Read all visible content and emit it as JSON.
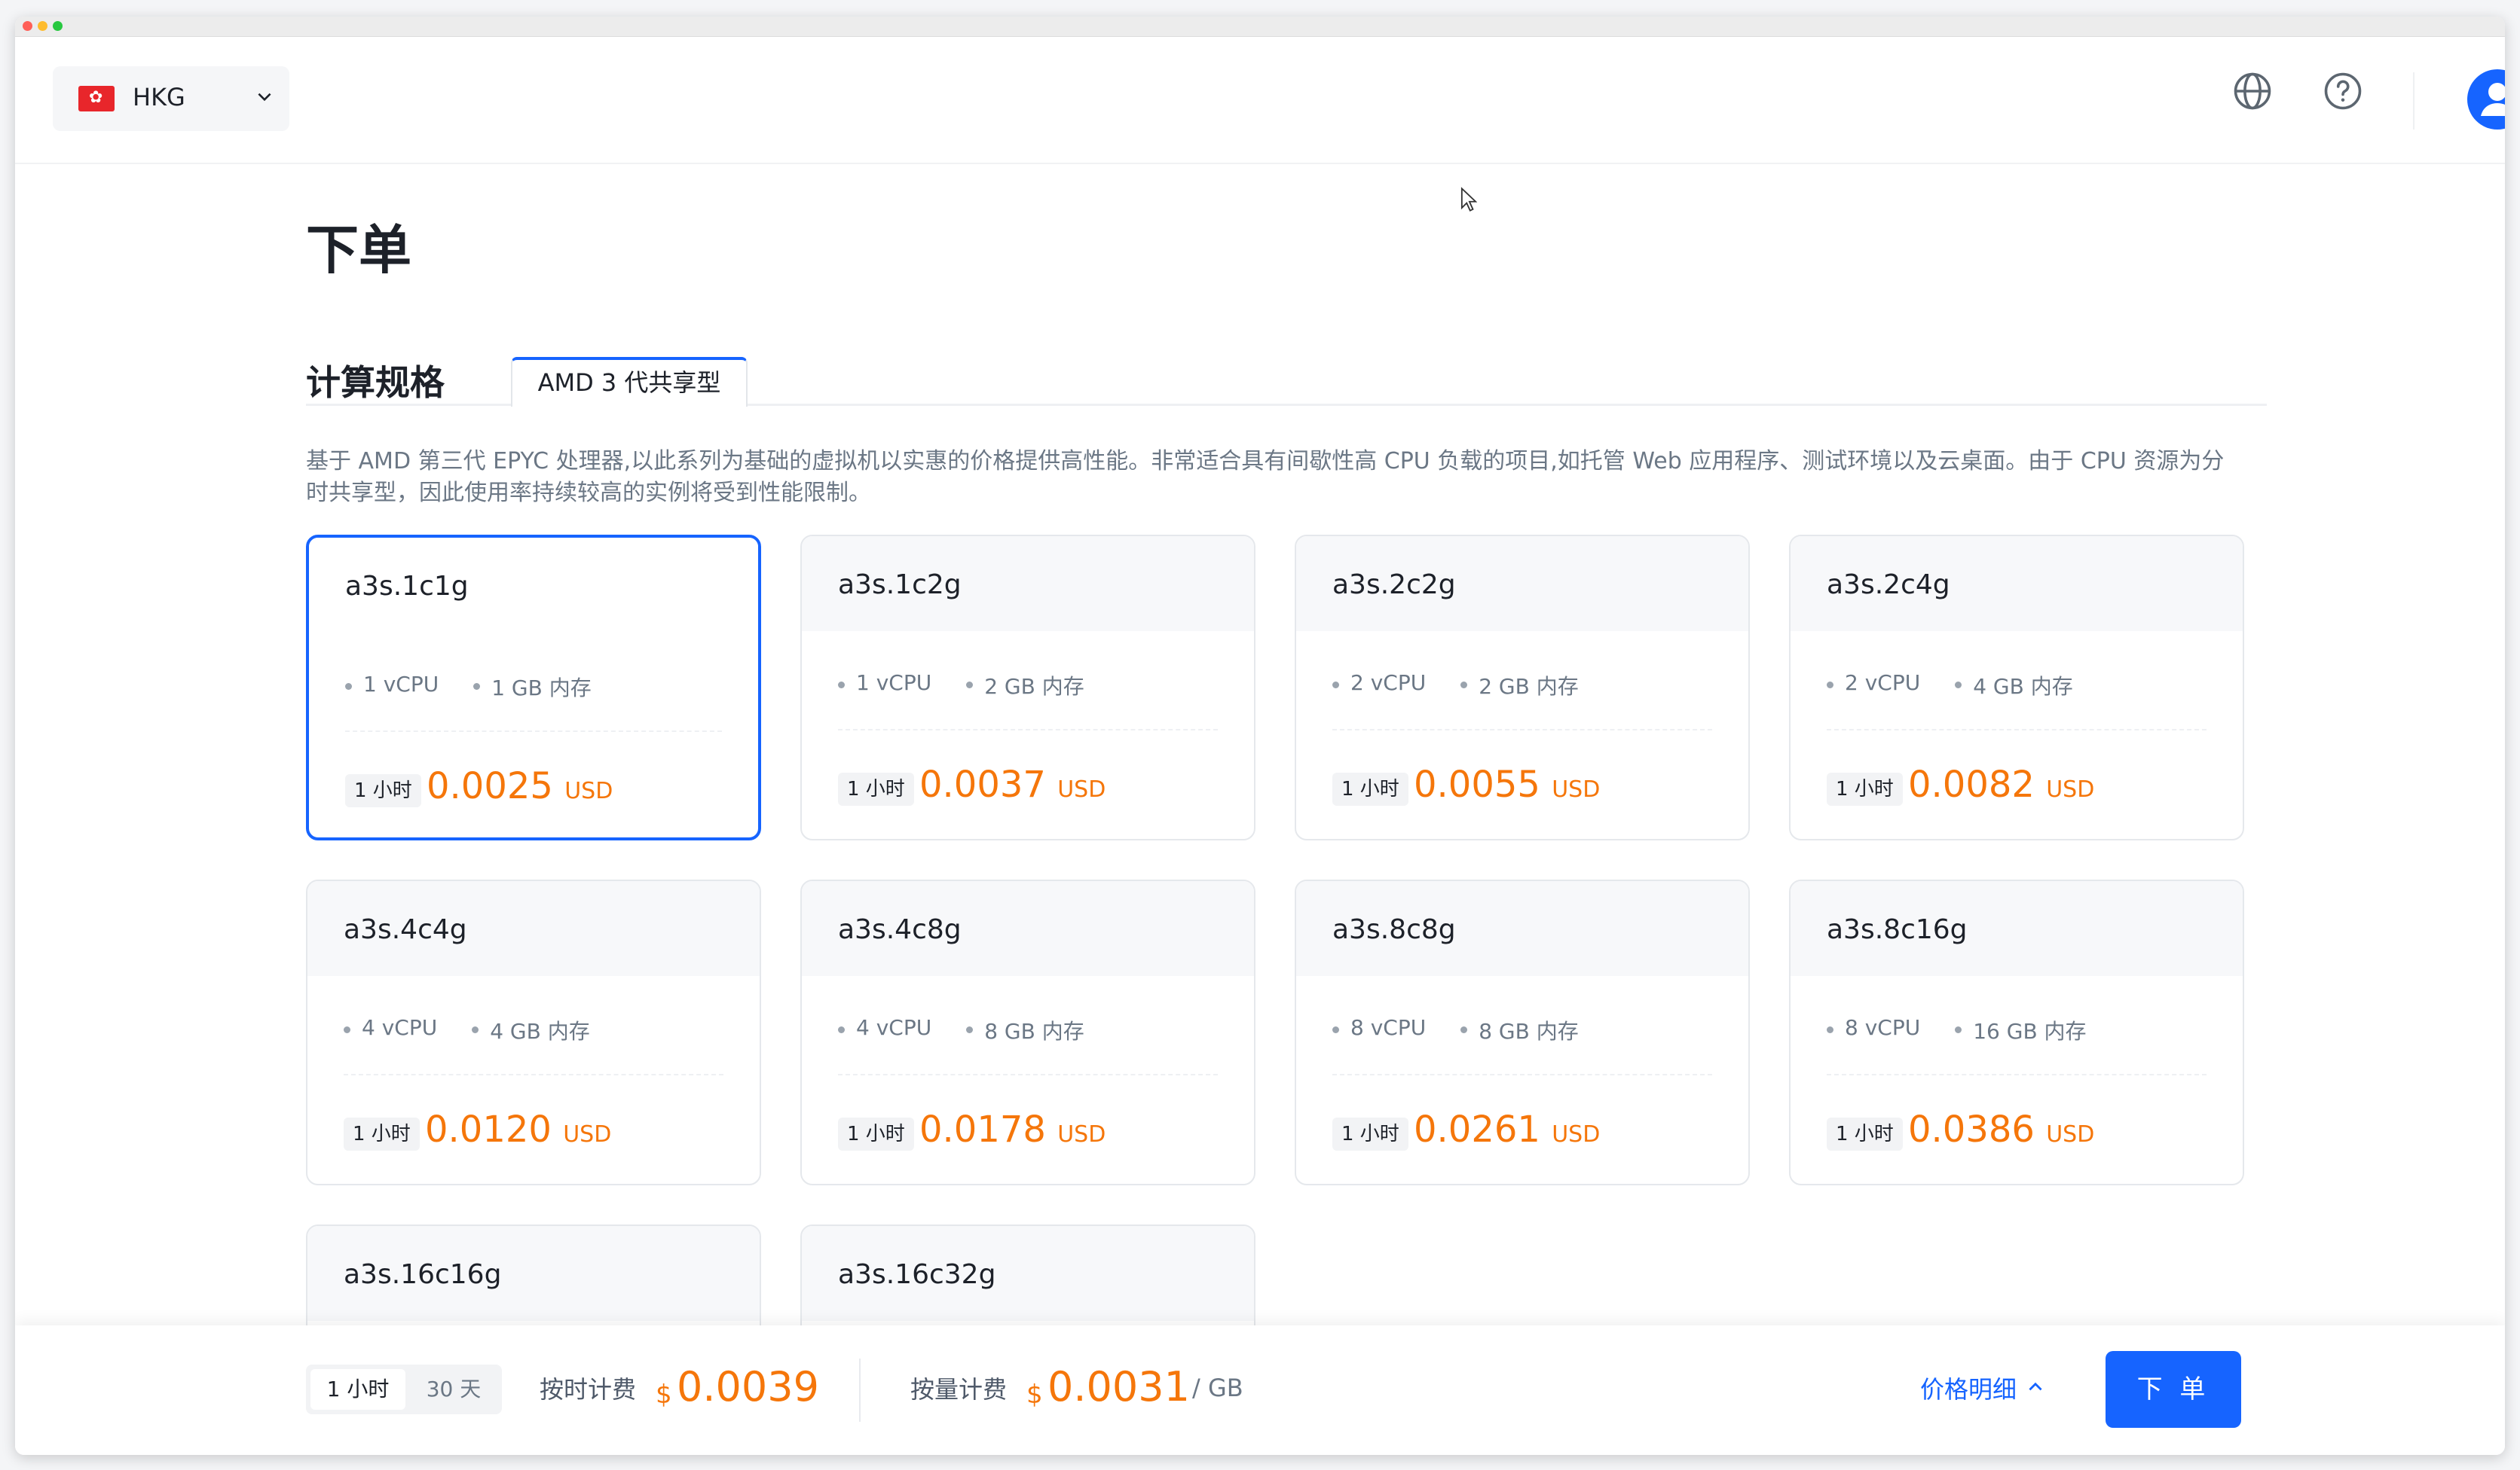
{
  "header": {
    "region": "HKG",
    "language_icon": "globe-icon",
    "help_icon": "question-circle-icon",
    "avatar_icon": "user-icon"
  },
  "page": {
    "title": "下单",
    "section_label": "计算规格",
    "active_tab": "AMD 3 代共享型",
    "description": "基于 AMD 第三代 EPYC 处理器,以此系列为基础的虚拟机以实惠的价格提供高性能。非常适合具有间歇性高 CPU 负载的项目,如托管 Web 应用程序、测试环境以及云桌面。由于 CPU 资源为分时共享型，因此使用率持续较高的实例将受到性能限制。"
  },
  "cards": [
    {
      "name": "a3s.1c1g",
      "cpu": "1 vCPU",
      "mem": "1 GB 内存",
      "period": "1 小时",
      "price": "0.0025",
      "unit": "USD",
      "selected": true
    },
    {
      "name": "a3s.1c2g",
      "cpu": "1 vCPU",
      "mem": "2 GB 内存",
      "period": "1 小时",
      "price": "0.0037",
      "unit": "USD"
    },
    {
      "name": "a3s.2c2g",
      "cpu": "2 vCPU",
      "mem": "2 GB 内存",
      "period": "1 小时",
      "price": "0.0055",
      "unit": "USD"
    },
    {
      "name": "a3s.2c4g",
      "cpu": "2 vCPU",
      "mem": "4 GB 内存",
      "period": "1 小时",
      "price": "0.0082",
      "unit": "USD"
    },
    {
      "name": "a3s.4c4g",
      "cpu": "4 vCPU",
      "mem": "4 GB 内存",
      "period": "1 小时",
      "price": "0.0120",
      "unit": "USD"
    },
    {
      "name": "a3s.4c8g",
      "cpu": "4 vCPU",
      "mem": "8 GB 内存",
      "period": "1 小时",
      "price": "0.0178",
      "unit": "USD"
    },
    {
      "name": "a3s.8c8g",
      "cpu": "8 vCPU",
      "mem": "8 GB 内存",
      "period": "1 小时",
      "price": "0.0261",
      "unit": "USD"
    },
    {
      "name": "a3s.8c16g",
      "cpu": "8 vCPU",
      "mem": "16 GB 内存",
      "period": "1 小时",
      "price": "0.0386",
      "unit": "USD"
    },
    {
      "name": "a3s.16c16g"
    },
    {
      "name": "a3s.16c32g"
    }
  ],
  "bottom": {
    "period_options": [
      "1 小时",
      "30 天"
    ],
    "hourly_label": "按时计费",
    "hourly_currency": "$",
    "hourly_price": "0.0039",
    "traffic_label": "按量计费",
    "traffic_currency": "$",
    "traffic_price": "0.0031",
    "traffic_unit": "/ GB",
    "details_label": "价格明细",
    "order_button": "下 单"
  },
  "colors": {
    "accent": "#1664ff",
    "price": "#f5760a"
  }
}
